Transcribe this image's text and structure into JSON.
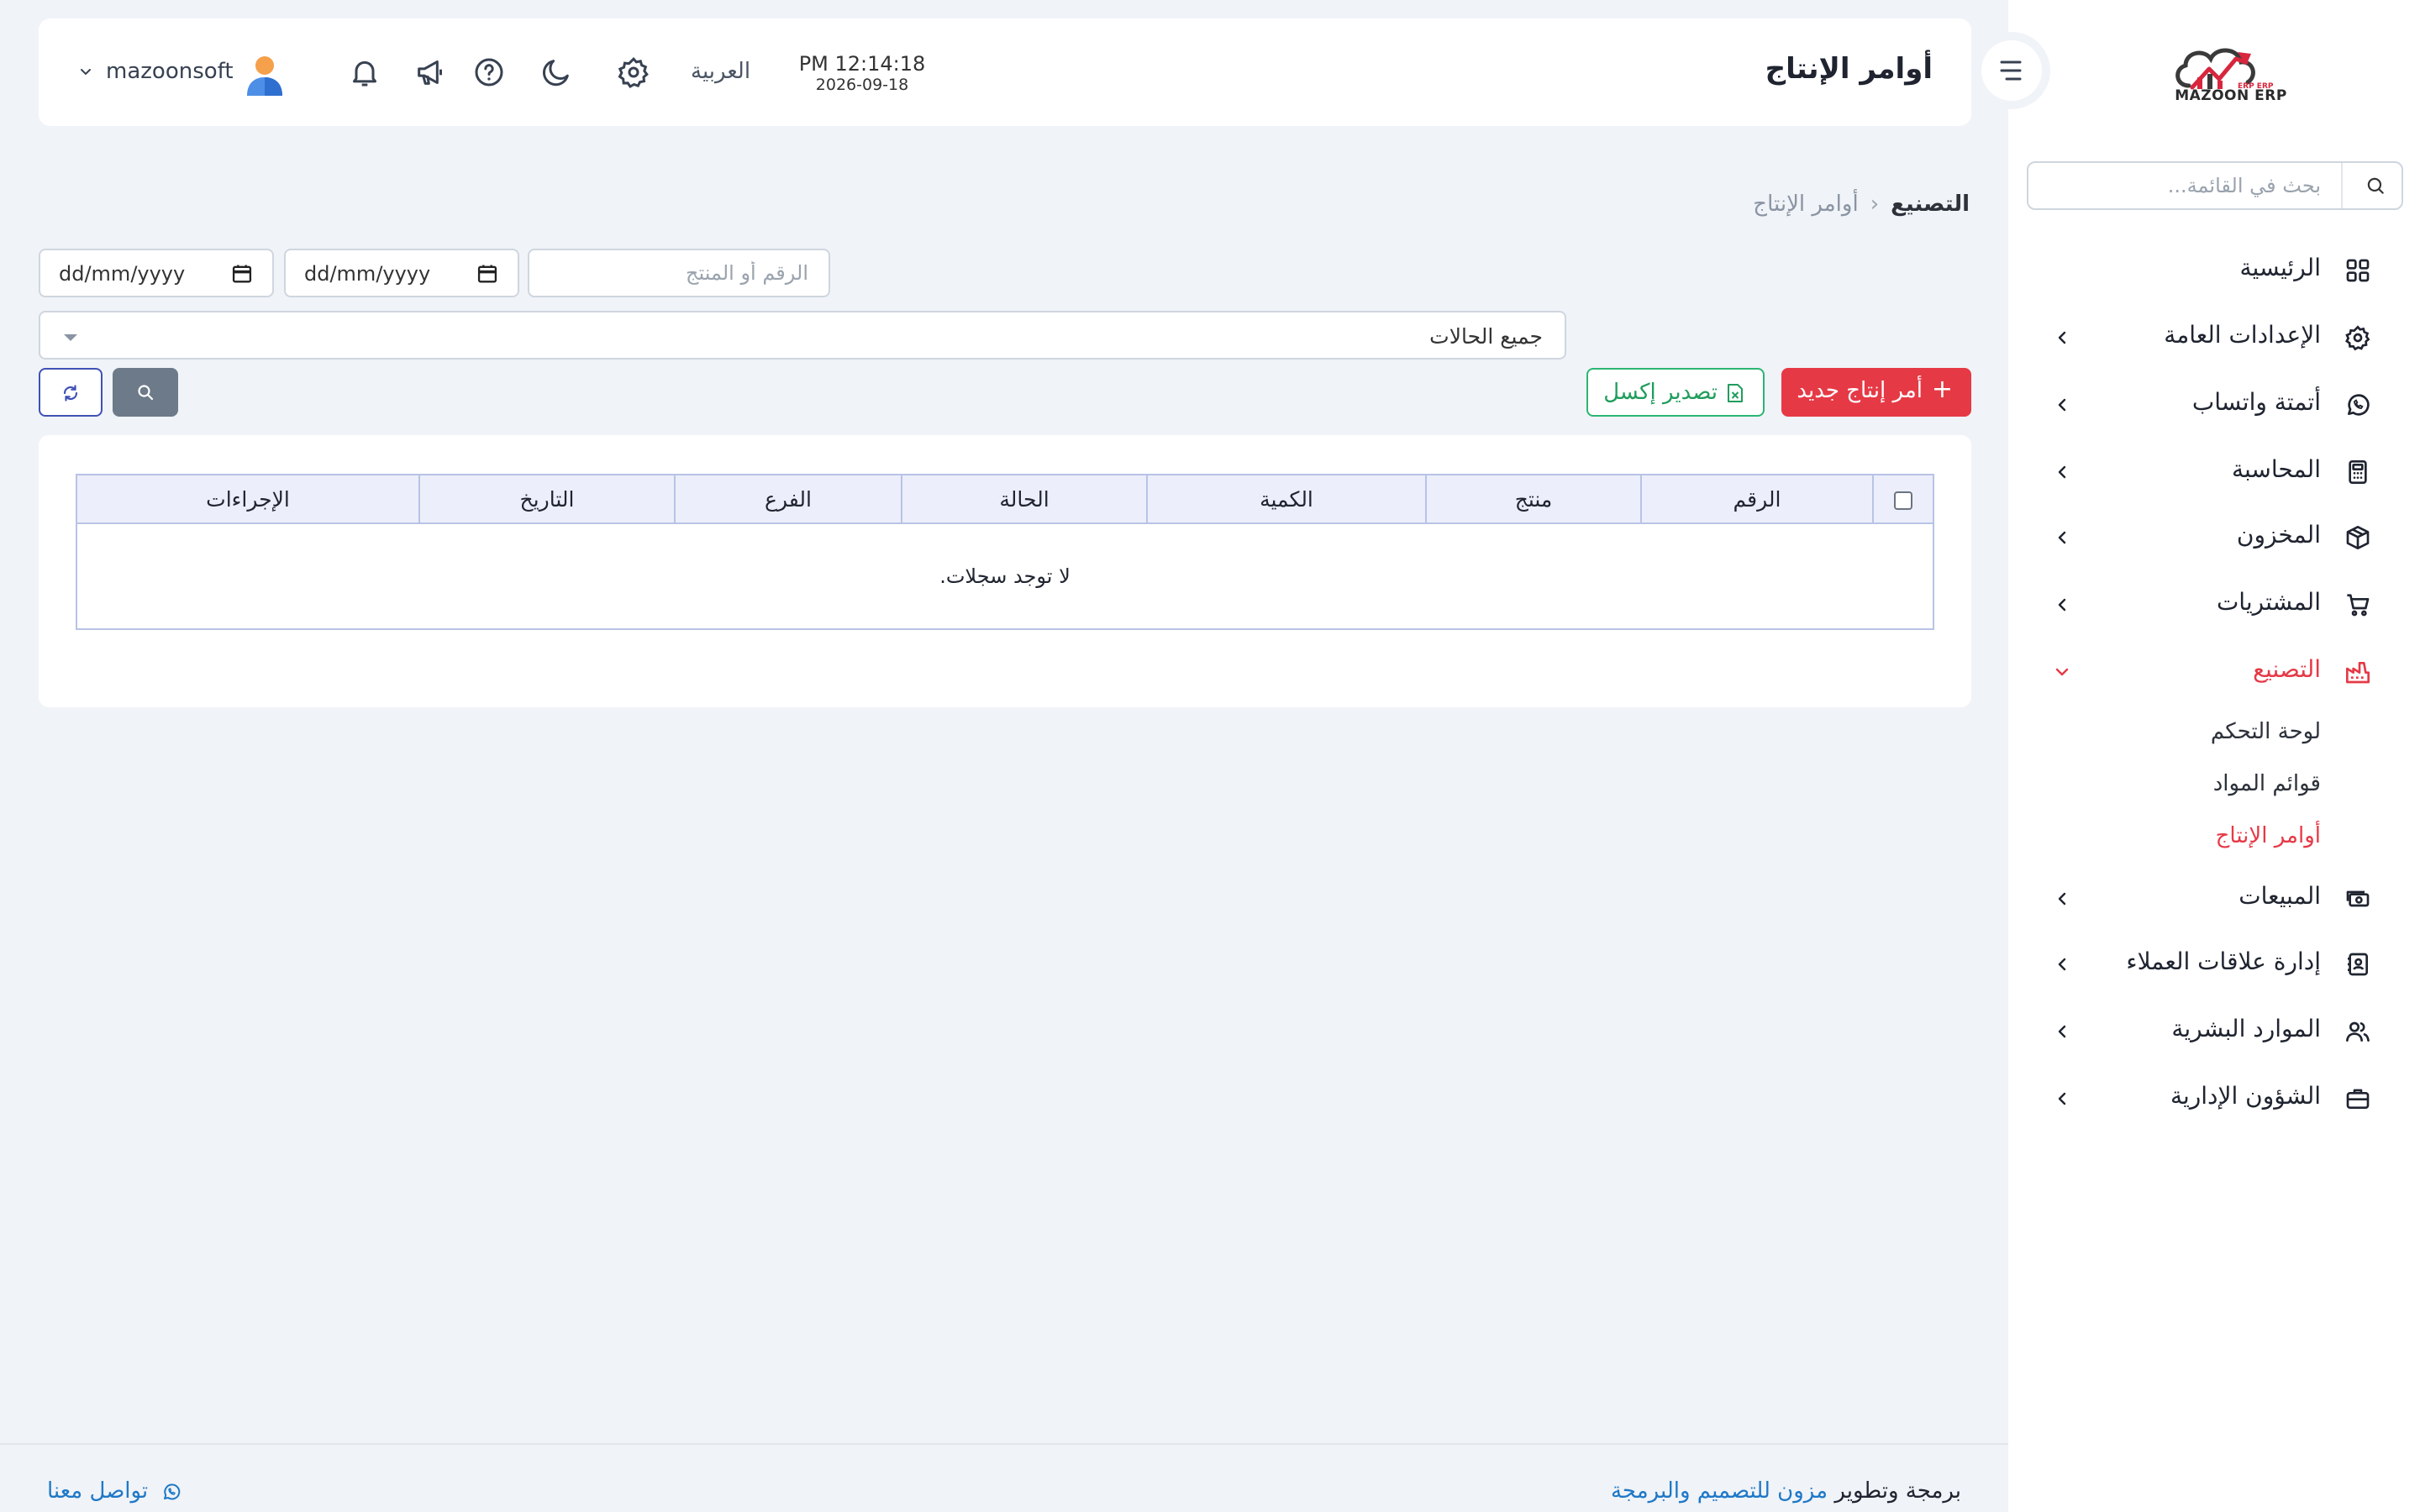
{
  "app": {
    "brand": "MAZOON ERP",
    "brand_sub": "ERP ERP"
  },
  "sidebar": {
    "search_placeholder": "بحث في القائمة...",
    "items": [
      {
        "label": "الرئيسية",
        "icon": "grid-icon"
      },
      {
        "label": "الإعدادات العامة",
        "icon": "gear-icon"
      },
      {
        "label": "أتمتة واتساب",
        "icon": "whatsapp-icon"
      },
      {
        "label": "المحاسبة",
        "icon": "calculator-icon"
      },
      {
        "label": "المخزون",
        "icon": "box-icon"
      },
      {
        "label": "المشتريات",
        "icon": "cart-icon"
      },
      {
        "label": "التصنيع",
        "icon": "factory-icon",
        "active": true
      },
      {
        "label": "المبيعات",
        "icon": "cash-icon"
      },
      {
        "label": "إدارة علاقات العملاء",
        "icon": "contacts-icon"
      },
      {
        "label": "الموارد البشرية",
        "icon": "users-icon"
      },
      {
        "label": "الشؤون الإدارية",
        "icon": "briefcase-icon"
      }
    ],
    "sub_items": [
      {
        "label": "لوحة التحكم"
      },
      {
        "label": "قوائم المواد"
      },
      {
        "label": "أوامر الإنتاج",
        "active": true
      }
    ]
  },
  "header": {
    "title": "أوامر الإنتاج",
    "time": "PM 12:14:18",
    "date": "2026-09-18",
    "language": "العربية",
    "user": "mazoonsoft"
  },
  "breadcrumb": {
    "parent": "التصنيع",
    "separator": "‹",
    "current": "أوامر الإنتاج"
  },
  "filters": {
    "date_from": "dd/mm/yyyy",
    "date_to": "dd/mm/yyyy",
    "search_placeholder": "الرقم أو المنتج",
    "status_value": "جميع الحالات"
  },
  "actions": {
    "new_label": "أمر إنتاج جديد",
    "new_plus": "+",
    "export_label": "تصدير إكسل"
  },
  "table": {
    "columns": [
      "الرقم",
      "منتج",
      "الكمية",
      "الحالة",
      "الفرع",
      "التاريخ",
      "الإجراءات"
    ],
    "empty_message": "لا توجد سجلات."
  },
  "footer": {
    "credit_prefix": "برمجة وتطوير",
    "credit_link": "مزون للتصميم والبرمجة",
    "contact": "تواصل معنا"
  },
  "colors": {
    "accent": "#e63946",
    "success": "#2bb673",
    "link": "#1e78c8",
    "primary_outline": "#3f51b5"
  }
}
